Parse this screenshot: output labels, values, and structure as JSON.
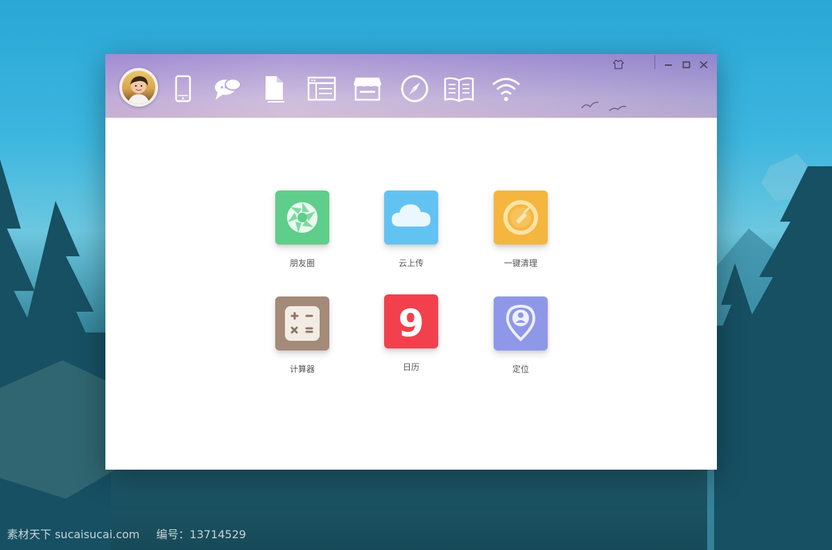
{
  "window": {
    "controls": [
      {
        "name": "skin-button",
        "icon": "shirt-icon"
      },
      {
        "name": "minimize-button",
        "icon": "minimize-icon"
      },
      {
        "name": "maximize-button",
        "icon": "maximize-icon"
      },
      {
        "name": "close-button",
        "icon": "close-icon"
      }
    ]
  },
  "toolbar": {
    "items": [
      {
        "name": "phone",
        "icon": "phone-icon"
      },
      {
        "name": "chat",
        "icon": "chat-bubbles-icon"
      },
      {
        "name": "files",
        "icon": "document-icon"
      },
      {
        "name": "browser",
        "icon": "browser-window-icon"
      },
      {
        "name": "store",
        "icon": "store-icon"
      },
      {
        "name": "discover",
        "icon": "compass-icon"
      },
      {
        "name": "reader",
        "icon": "book-icon"
      },
      {
        "name": "wifi",
        "icon": "wifi-icon"
      }
    ]
  },
  "apps": [
    {
      "label": "朋友圈",
      "icon": "shutter-icon",
      "color": "#5fce8a"
    },
    {
      "label": "云上传",
      "icon": "cloud-icon",
      "color": "#62c3f3"
    },
    {
      "label": "一键清理",
      "icon": "broom-icon",
      "color": "#f5b640"
    },
    {
      "label": "计算器",
      "icon": "calculator-icon",
      "color": "#a48a79"
    },
    {
      "label": "日历",
      "icon": "calendar-nine-icon",
      "color": "#f2414c",
      "text": "9"
    },
    {
      "label": "定位",
      "icon": "location-pin-icon",
      "color": "#8f98e8"
    }
  ],
  "watermark": {
    "site": "素材天下 sucaisucai.com",
    "number": "编号：13714529"
  }
}
